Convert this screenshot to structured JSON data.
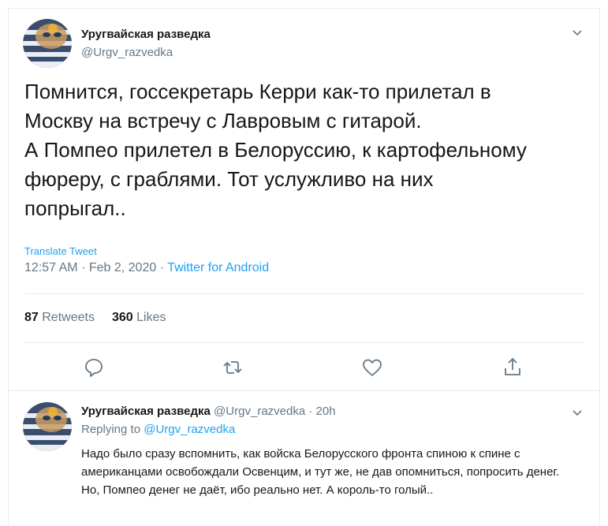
{
  "main_tweet": {
    "author_name": "Уругвайская разведка",
    "author_handle": "@Urgv_razvedka",
    "text": "Помнится, госсекретарь Керри как-то прилетал в\nМоскву на встречу с Лавровым с гитарой.\nА Помпео прилетел в Белоруссию, к картофельному\nфюреру, с граблями. Тот услужливо на них\nпопрыгал..",
    "translate_label": "Translate Tweet",
    "time": "12:57 AM",
    "dot": "·",
    "date": "Feb 2, 2020",
    "source": "Twitter for Android",
    "retweets_count": "87",
    "retweets_label": "Retweets",
    "likes_count": "360",
    "likes_label": "Likes"
  },
  "reply_tweet": {
    "author_name": "Уругвайская разведка",
    "author_handle": "@Urgv_razvedka",
    "dot": "·",
    "age": "20h",
    "replying_prefix": "Replying to",
    "replying_handle": "@Urgv_razvedka",
    "text": "Надо было сразу вспомнить, как войска Белорусского фронта спиною к спине с американцами освобождали Освенцим, и тут же, не дав опомниться, попросить денег. Но, Помпео денег не даёт, ибо реально нет. А король-то голый.."
  },
  "icons": {
    "reply": "reply-icon",
    "retweet": "retweet-icon",
    "like": "heart-icon",
    "share": "share-icon",
    "more": "chevron-down-icon"
  },
  "colors": {
    "accent": "#1da1f2",
    "secondary_text": "#657786",
    "divider": "#e6ecf0"
  }
}
